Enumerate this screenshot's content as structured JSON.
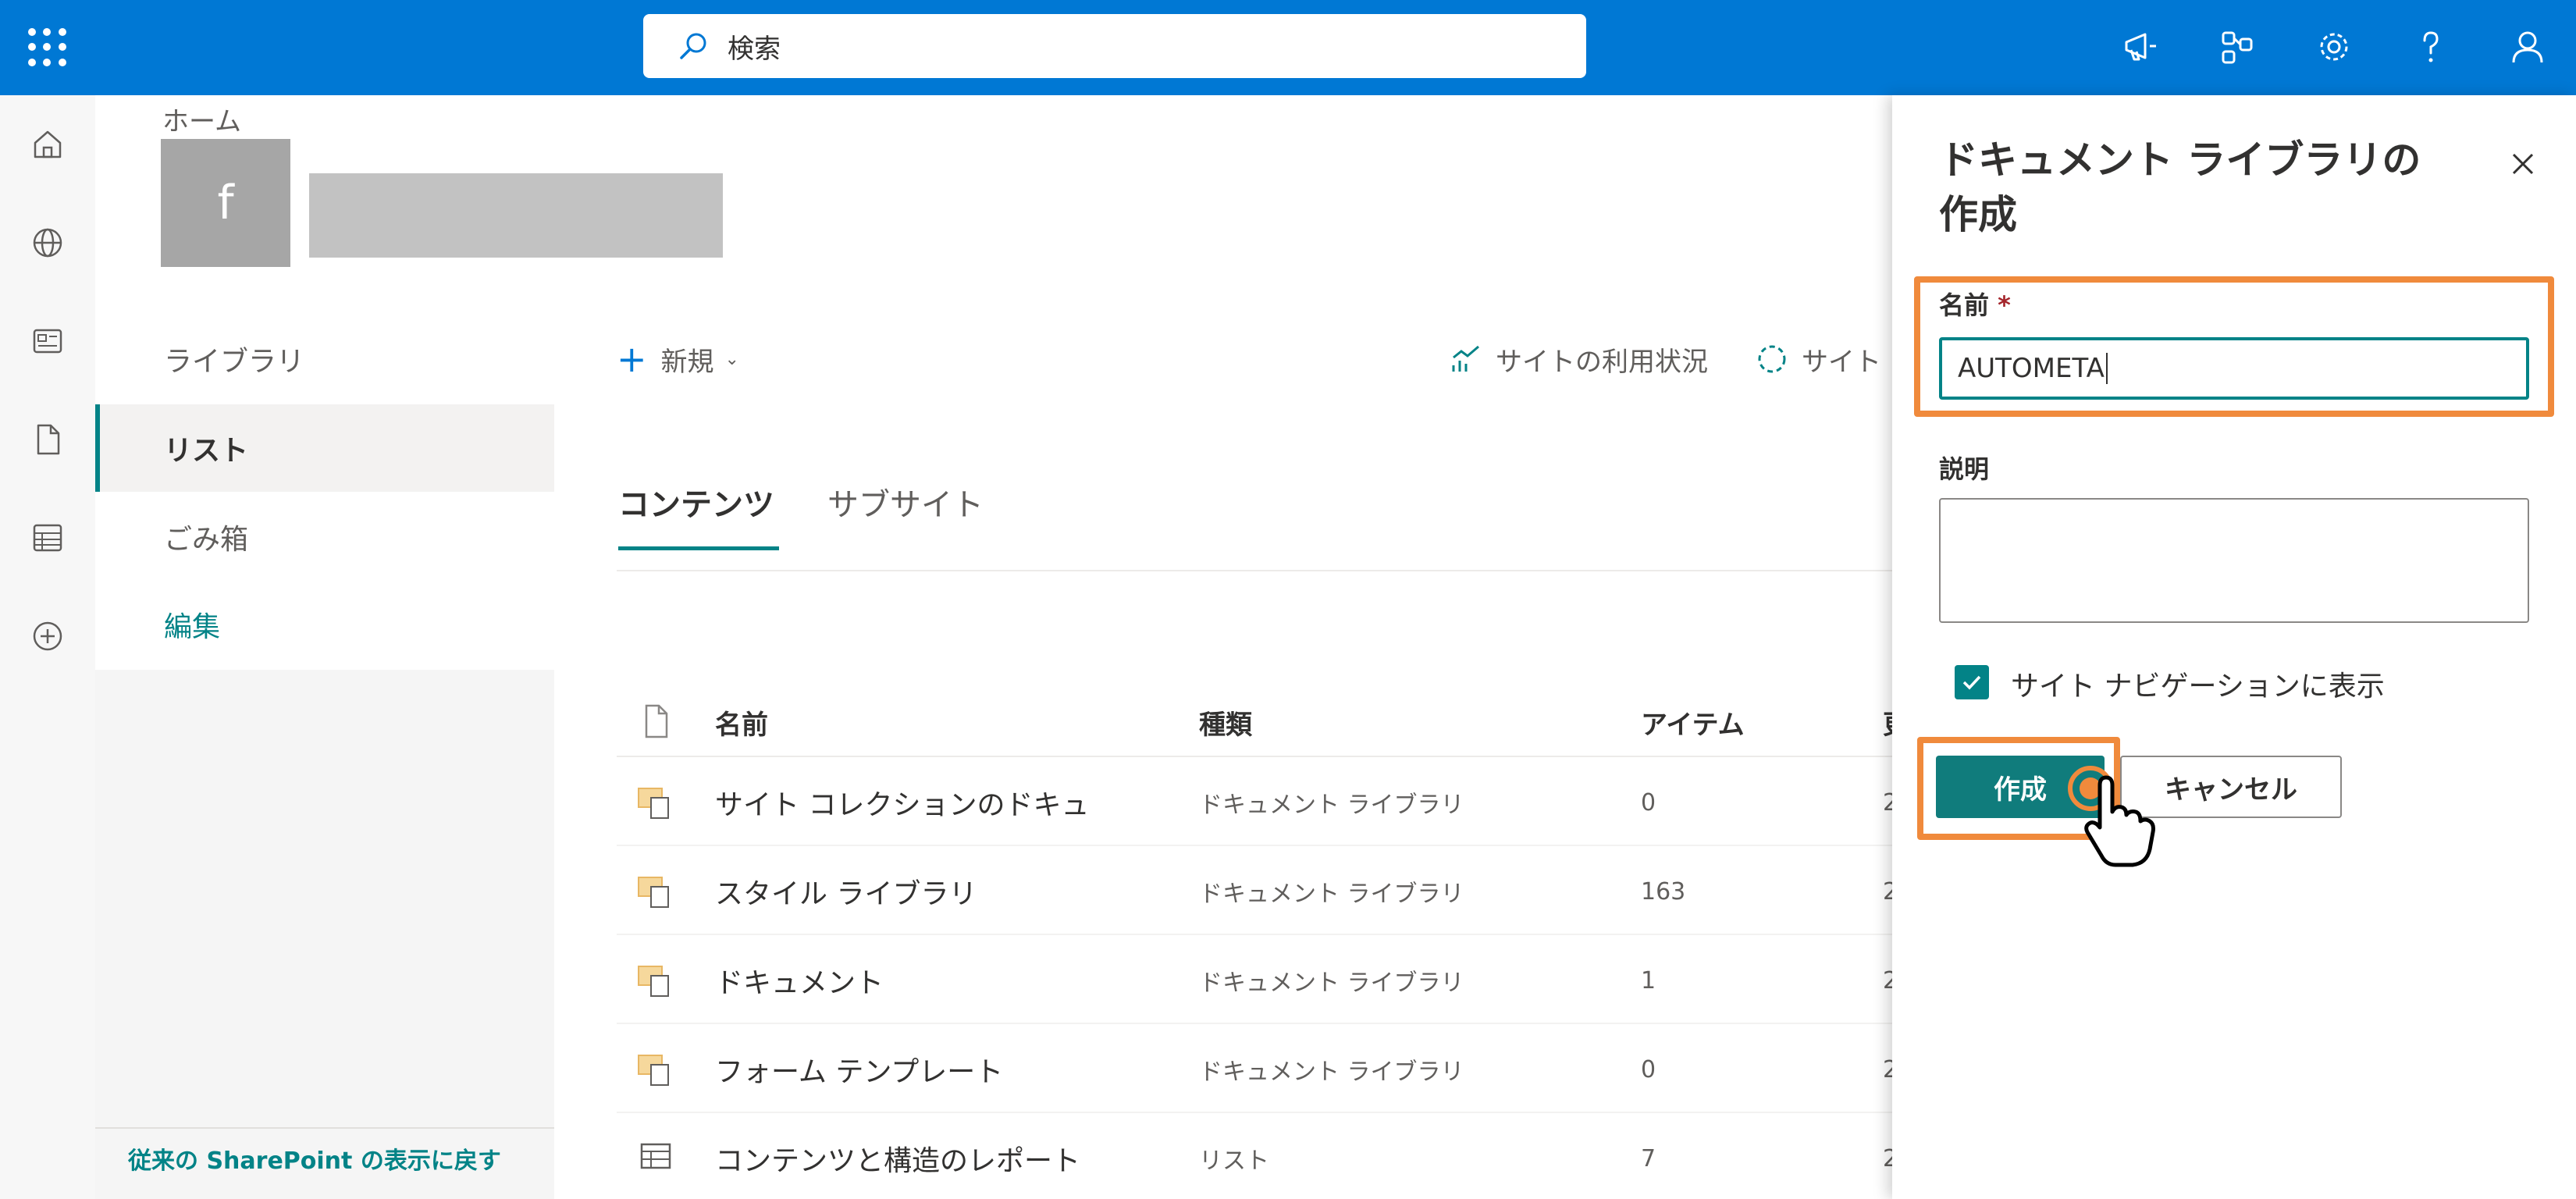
{
  "topbar": {
    "search_placeholder": "検索",
    "icons": [
      "app-launcher-icon",
      "search-icon",
      "megaphone-icon",
      "connections-icon",
      "gear-icon",
      "help-icon",
      "account-icon"
    ]
  },
  "rail": {
    "icons": [
      "home-icon",
      "globe-icon",
      "news-icon",
      "file-icon",
      "lists-icon",
      "create-icon"
    ]
  },
  "site": {
    "breadcrumb": "ホーム",
    "logo_letter": "f"
  },
  "leftnav": {
    "items": [
      {
        "label": "ライブラリ"
      },
      {
        "label": "リスト"
      },
      {
        "label": "ごみ箱"
      },
      {
        "label": "編集"
      }
    ],
    "classic_link": "従来の SharePoint の表示に戻す"
  },
  "commands": {
    "new_label": "新規",
    "usage_label": "サイトの利用状況",
    "workflow_label": "サイト"
  },
  "tabs": [
    {
      "label": "コンテンツ"
    },
    {
      "label": "サブサイト"
    }
  ],
  "table": {
    "headers": {
      "name": "名前",
      "type": "種類",
      "items": "アイテム",
      "modified": "更"
    },
    "rows": [
      {
        "name": "サイト コレクションのドキュ",
        "type": "ドキュメント ライブラリ",
        "count": "0",
        "trunc": "2"
      },
      {
        "name": "スタイル ライブラリ",
        "type": "ドキュメント ライブラリ",
        "count": "163",
        "trunc": "2"
      },
      {
        "name": "ドキュメント",
        "type": "ドキュメント ライブラリ",
        "count": "1",
        "trunc": "2"
      },
      {
        "name": "フォーム テンプレート",
        "type": "ドキュメント ライブラリ",
        "count": "0",
        "trunc": "2"
      },
      {
        "name": "コンテンツと構造のレポート",
        "type": "リスト",
        "count": "7",
        "trunc": "2"
      }
    ]
  },
  "panel": {
    "title": "ドキュメント ライブラリの作成",
    "name_label": "名前",
    "required_mark": "*",
    "name_value": "AUTOMETA",
    "description_label": "説明",
    "show_in_nav_label": "サイト ナビゲーションに表示",
    "show_in_nav_checked": true,
    "create_label": "作成",
    "cancel_label": "キャンセル"
  },
  "colors": {
    "suite_bar": "#0078d4",
    "accent": "#038387",
    "highlight": "#f08a3c"
  }
}
